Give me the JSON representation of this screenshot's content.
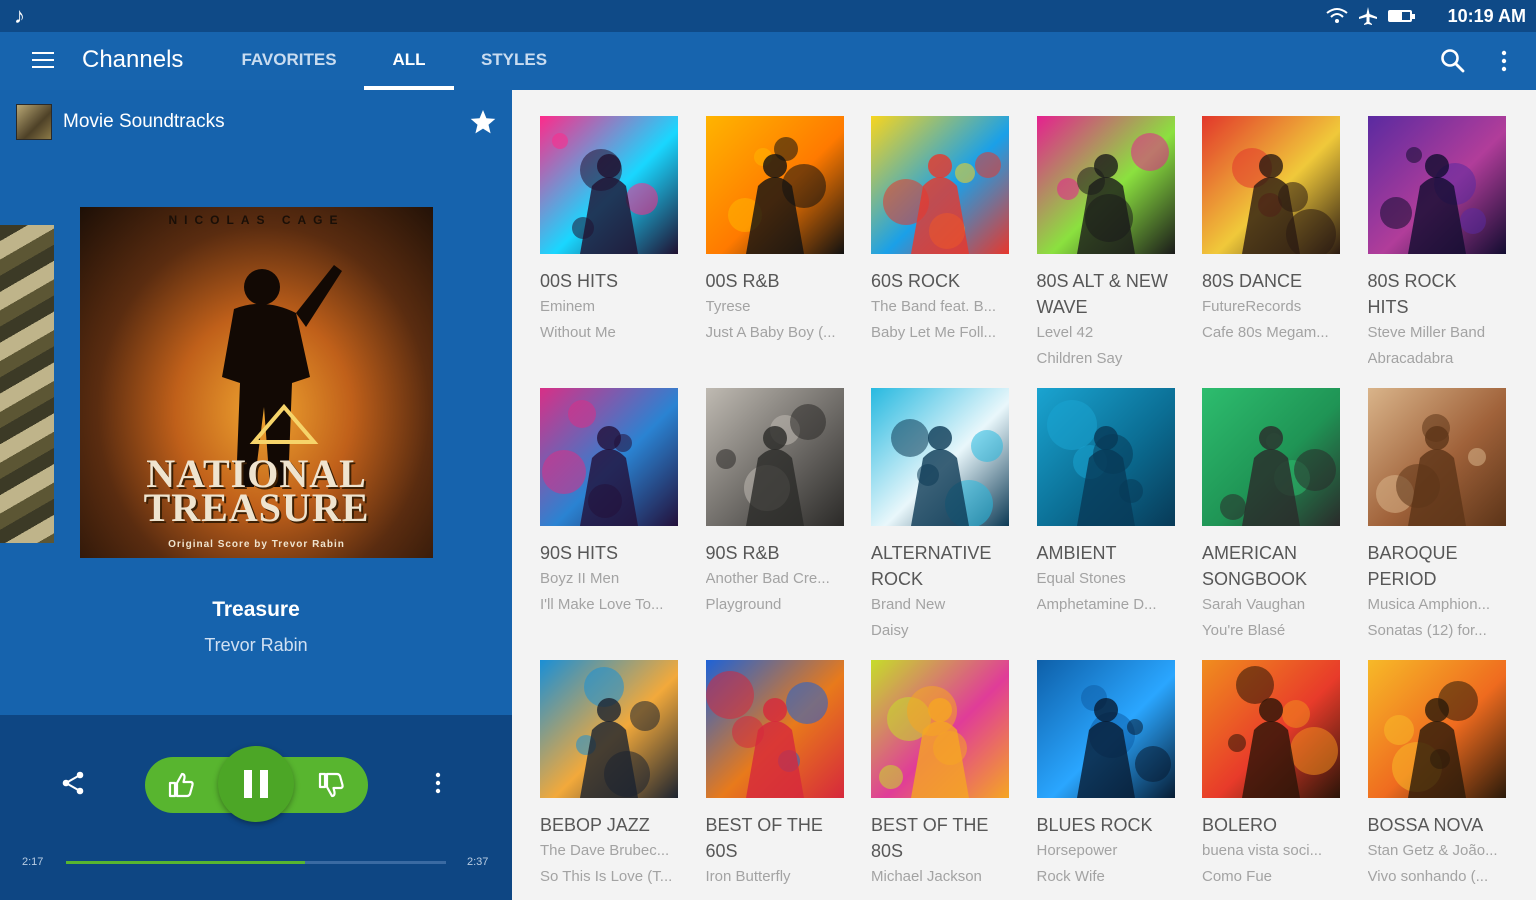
{
  "status_bar": {
    "time": "10:19 AM",
    "icons": [
      "wifi-icon",
      "airplane-icon",
      "battery-icon"
    ]
  },
  "app_bar": {
    "title": "Channels",
    "tabs": [
      {
        "label": "FAVORITES",
        "active": false
      },
      {
        "label": "ALL",
        "active": true
      },
      {
        "label": "STYLES",
        "active": false
      }
    ],
    "actions": [
      "search-icon",
      "overflow-menu-icon"
    ]
  },
  "now_playing": {
    "channel_name": "Movie Soundtracks",
    "favorited": true,
    "album_art": {
      "top_text": "NICOLAS CAGE",
      "title_line1": "NATIONAL",
      "title_line2": "TREASURE",
      "subtitle": "Original Score by Trevor Rabin"
    },
    "track_title": "Treasure",
    "track_artist": "Trevor Rabin",
    "elapsed": "2:17",
    "duration": "2:37",
    "progress": 0.63,
    "controls": [
      "share-icon",
      "thumbs-up-icon",
      "pause-icon",
      "thumbs-down-icon",
      "more-icon"
    ]
  },
  "channels": [
    {
      "name": "00S HITS",
      "artist": "Eminem",
      "song": "Without Me",
      "art": "disco-speaker-art",
      "c1": "#ff2a8a",
      "c2": "#19d7ff",
      "c3": "#201030"
    },
    {
      "name": "00S R&B",
      "artist": "Tyrese",
      "song": "Just A Baby Boy (...",
      "art": "rnb-silhouette-art",
      "c1": "#ffb400",
      "c2": "#ff7a00",
      "c3": "#111111"
    },
    {
      "name": "60S ROCK",
      "artist": "The Band feat. B...",
      "song": "Baby Let Me Foll...",
      "art": "psychedelic-notes-art",
      "c1": "#f7d51f",
      "c2": "#1aa0e8",
      "c3": "#e8372c"
    },
    {
      "name": "80S ALT & NEW WAVE",
      "artist": "Level 42",
      "song": "Children Say",
      "art": "new-wave-zigzag-art",
      "c1": "#e5208f",
      "c2": "#8be13f",
      "c3": "#1a1a1a"
    },
    {
      "name": "80S DANCE",
      "artist": "FutureRecords",
      "song": "Cafe 80s Megam...",
      "art": "retro-circles-art",
      "c1": "#e2372b",
      "c2": "#f0c93a",
      "c3": "#2a1a12"
    },
    {
      "name": "80S ROCK HITS",
      "artist": "Steve Miller Band",
      "song": "Abracadabra",
      "art": "rock-crowd-art",
      "c1": "#5a2aa0",
      "c2": "#b13d9a",
      "c3": "#120c30"
    },
    {
      "name": "90S HITS",
      "artist": "Boyz II Men",
      "song": "I'll Make Love To...",
      "art": "mirror-ball-art",
      "c1": "#d82f86",
      "c2": "#2a83d2",
      "c3": "#23103a"
    },
    {
      "name": "90S R&B",
      "artist": "Another Bad Cre...",
      "song": "Playground",
      "art": "grunge-singer-art",
      "c1": "#bfbab2",
      "c2": "#6d6a66",
      "c3": "#2b2a28"
    },
    {
      "name": "ALTERNATIVE ROCK",
      "artist": "Brand New",
      "song": "Daisy",
      "art": "guitarist-splash-art",
      "c1": "#27b9e0",
      "c2": "#e9f7fb",
      "c3": "#0d3a55"
    },
    {
      "name": "AMBIENT",
      "artist": "Equal Stones",
      "song": "Amphetamine D...",
      "art": "blue-cube-art",
      "c1": "#1aa4d1",
      "c2": "#0b6e94",
      "c3": "#083a57"
    },
    {
      "name": "AMERICAN SONGBOOK",
      "artist": "Sarah Vaughan",
      "song": "You're Blasé",
      "art": "crooner-mic-art",
      "c1": "#2dbd6e",
      "c2": "#1f9455",
      "c3": "#2a2a2a"
    },
    {
      "name": "BAROQUE PERIOD",
      "artist": "Musica Amphion...",
      "song": "Sonatas (12) for...",
      "art": "violin-parchment-art",
      "c1": "#d9b48a",
      "c2": "#a0623a",
      "c3": "#5c3418"
    },
    {
      "name": "BEBOP JAZZ",
      "artist": "The Dave Brubec...",
      "song": "So This Is Love (T...",
      "art": "jazz-band-art",
      "c1": "#1a8fd6",
      "c2": "#f2a93b",
      "c3": "#1c2330"
    },
    {
      "name": "BEST OF THE 60S",
      "artist": "Iron Butterfly",
      "song": "",
      "art": "dancing-crowd-art",
      "c1": "#1e62d6",
      "c2": "#e87a1b",
      "c3": "#d6283c"
    },
    {
      "name": "BEST OF THE 80S",
      "artist": "Michael Jackson",
      "song": "",
      "art": "cassette-tape-art",
      "c1": "#c6dc2a",
      "c2": "#e03c98",
      "c3": "#f5a623"
    },
    {
      "name": "BLUES ROCK",
      "artist": "Horsepower",
      "song": "Rock Wife",
      "art": "guitar-silhouettes-art",
      "c1": "#0e5fa8",
      "c2": "#2aa6ff",
      "c3": "#071c33"
    },
    {
      "name": "BOLERO",
      "artist": "buena vista soci...",
      "song": "Como Fue",
      "art": "vintage-mic-art",
      "c1": "#f08d1e",
      "c2": "#e83b2a",
      "c3": "#2a1408"
    },
    {
      "name": "BOSSA NOVA",
      "artist": "Stan Getz & João...",
      "song": "Vivo sonhando (...",
      "art": "palm-sunset-art",
      "c1": "#f7b928",
      "c2": "#ef6b1f",
      "c3": "#2a1a0a"
    }
  ]
}
